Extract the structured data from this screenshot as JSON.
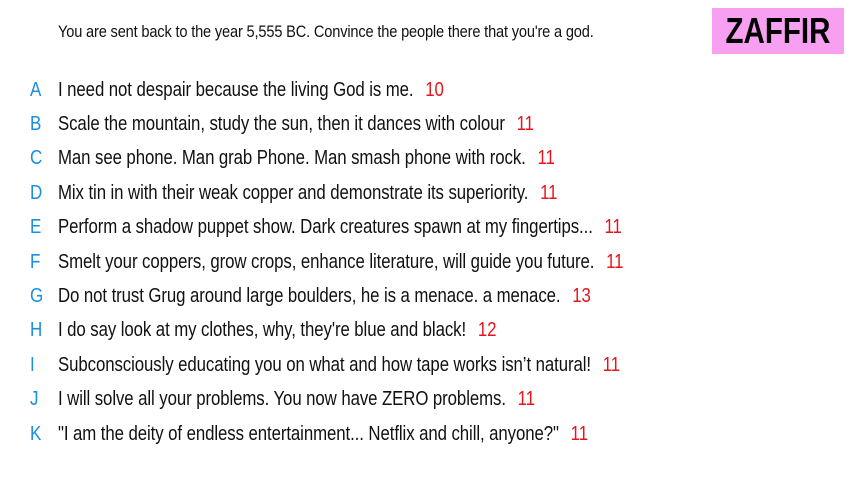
{
  "prompt": "You are sent back to the year 5,555 BC. Convince the people there that you're a god.",
  "brand": "ZAFFIR",
  "colors": {
    "letter": "#1a8fe0",
    "score": "#e8141b",
    "brand_bg": "#f79ff0"
  },
  "answers": [
    {
      "letter": "A",
      "text": "I need not despair because the living God is me.",
      "score": "10"
    },
    {
      "letter": "B",
      "text": "Scale the mountain, study the sun, then it dances with colour",
      "score": "11"
    },
    {
      "letter": "C",
      "text": "Man see phone. Man grab Phone. Man smash phone with rock.",
      "score": "11"
    },
    {
      "letter": "D",
      "text": "Mix tin in with their weak copper and demonstrate its superiority.",
      "score": "11"
    },
    {
      "letter": "E",
      "text": "Perform a shadow puppet show. Dark creatures spawn at my fingertips...",
      "score": "11"
    },
    {
      "letter": "F",
      "text": "Smelt your coppers, grow crops, enhance literature, will guide you future.",
      "score": "11"
    },
    {
      "letter": "G",
      "text": "Do not trust Grug around large boulders, he is a menace. a menace.",
      "score": "13"
    },
    {
      "letter": "H",
      "text": "I do say look at my clothes, why, they're blue and black!",
      "score": "12"
    },
    {
      "letter": "I",
      "text": "Subconsciously educating you on what and how tape works isn’t natural!",
      "score": "11"
    },
    {
      "letter": "J",
      "text": "I will solve all your problems. You now have ZERO problems.",
      "score": "11"
    },
    {
      "letter": "K",
      "text": "\"I am the deity of endless entertainment... Netflix and chill, anyone?\"",
      "score": "11"
    }
  ]
}
